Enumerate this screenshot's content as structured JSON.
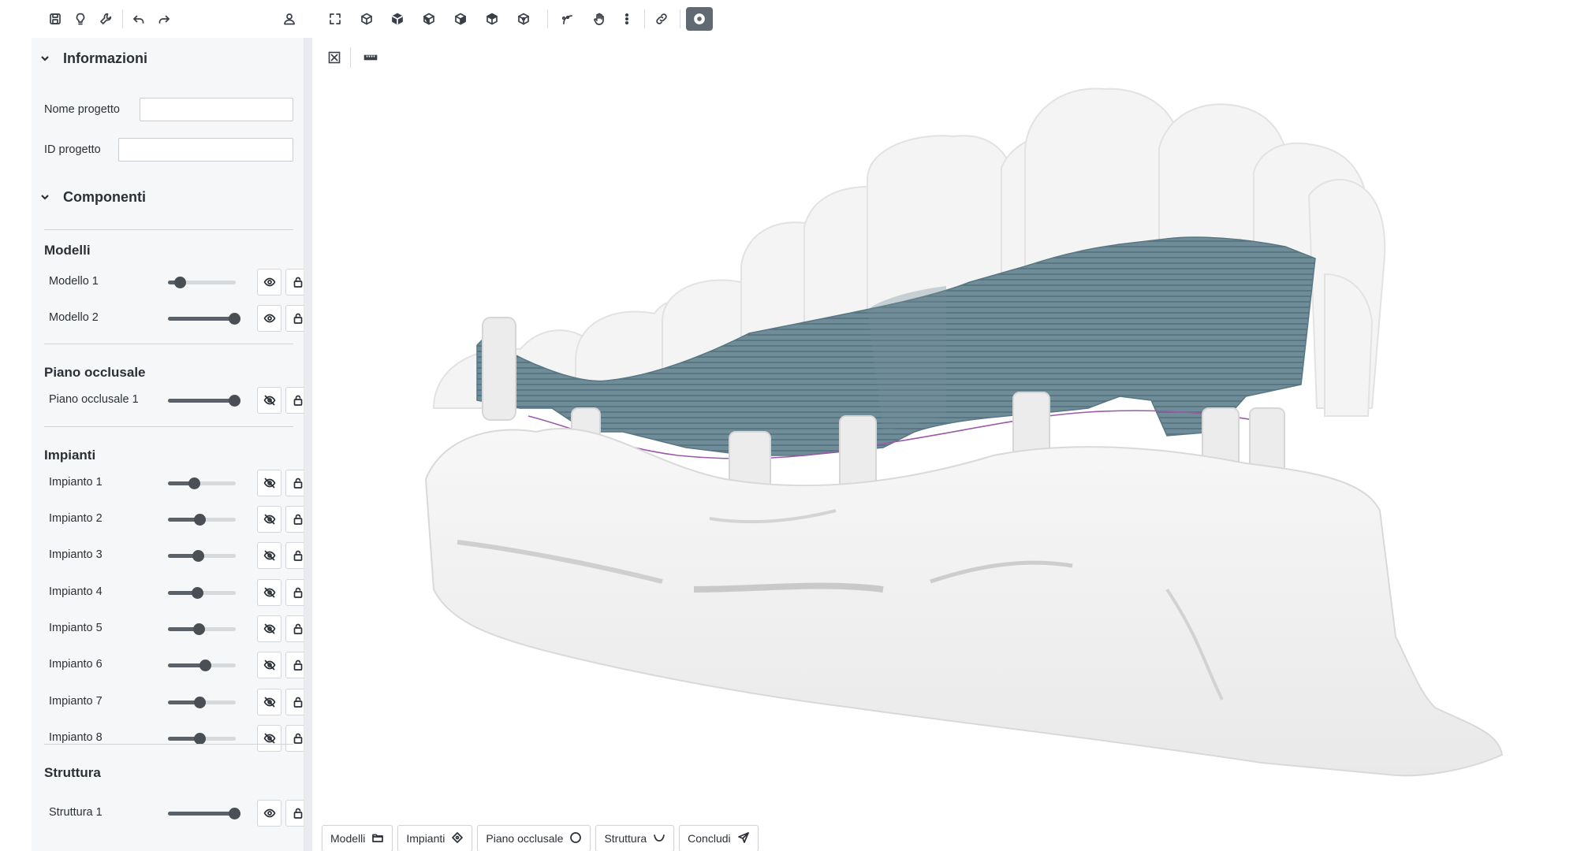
{
  "toolbar": {
    "left_icons": [
      "save-icon",
      "lightbulb-icon",
      "wrench-icon",
      "undo-icon",
      "redo-icon"
    ],
    "user_icon": "user-icon",
    "view_icons": [
      "fullscreen-icon",
      "cube-view-1-icon",
      "cube-view-2-icon",
      "cube-view-3-icon",
      "cube-view-4-icon",
      "cube-view-5-icon",
      "cube-view-6-icon",
      "curve-tool-icon",
      "hand-pan-icon",
      "more-vertical-icon",
      "link-icon",
      "disc-toggle-icon"
    ]
  },
  "info": {
    "title": "Informazioni",
    "project_name_label": "Nome progetto",
    "project_name_value": "",
    "project_id_label": "ID progetto",
    "project_id_value": ""
  },
  "components": {
    "title": "Componenti",
    "groups": [
      {
        "title": "Modelli",
        "items": [
          {
            "label": "Modello 1",
            "level": 0.18,
            "visible": true
          },
          {
            "label": "Modello 2",
            "level": 0.98,
            "visible": true
          }
        ]
      },
      {
        "title": "Piano occlusale",
        "items": [
          {
            "label": "Piano occlusale 1",
            "level": 0.98,
            "visible": false
          }
        ]
      },
      {
        "title": "Impianti",
        "items": [
          {
            "label": "Impianto 1",
            "level": 0.38,
            "visible": false
          },
          {
            "label": "Impianto 2",
            "level": 0.46,
            "visible": false
          },
          {
            "label": "Impianto 3",
            "level": 0.44,
            "visible": false
          },
          {
            "label": "Impianto 4",
            "level": 0.43,
            "visible": false
          },
          {
            "label": "Impianto 5",
            "level": 0.45,
            "visible": false
          },
          {
            "label": "Impianto 6",
            "level": 0.55,
            "visible": false
          },
          {
            "label": "Impianto 7",
            "level": 0.46,
            "visible": false
          },
          {
            "label": "Impianto 8",
            "level": 0.46,
            "visible": false
          }
        ]
      },
      {
        "title": "Struttura",
        "items": [
          {
            "label": "Struttura 1",
            "level": 0.98,
            "visible": true
          }
        ]
      }
    ]
  },
  "viewport": {
    "tools": [
      "close-box-icon",
      "ruler-icon"
    ]
  },
  "steps": [
    {
      "label": "Modelli",
      "icon": "folder-icon"
    },
    {
      "label": "Impianti",
      "icon": "diamond-icon"
    },
    {
      "label": "Piano occlusale",
      "icon": "circle-icon"
    },
    {
      "label": "Struttura",
      "icon": "arch-icon"
    },
    {
      "label": "Concludi",
      "icon": "send-icon"
    }
  ],
  "colors": {
    "bar_teal": "#6f8c99",
    "bar_teal_dark": "#5a7683",
    "model_white": "#f1f1f1",
    "occlusal_line": "#9b5aa8"
  }
}
